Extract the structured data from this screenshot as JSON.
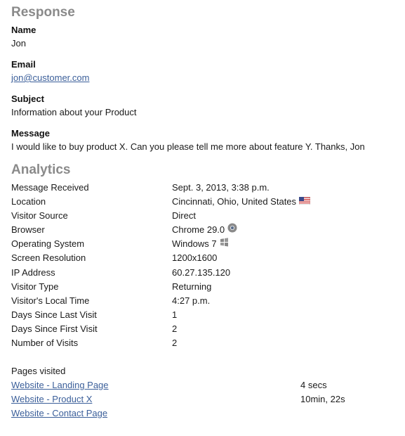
{
  "response": {
    "heading": "Response",
    "fields": [
      {
        "label": "Name",
        "value": "Jon",
        "is_link": false
      },
      {
        "label": "Email",
        "value": "jon@customer.com",
        "is_link": true
      },
      {
        "label": "Subject",
        "value": "Information about your Product",
        "is_link": false
      },
      {
        "label": "Message",
        "value": "I would like to buy product X. Can you please tell me more about feature Y. Thanks, Jon",
        "is_link": false
      }
    ]
  },
  "analytics": {
    "heading": "Analytics",
    "rows": [
      {
        "key": "Message Received",
        "value": "Sept. 3, 2013, 3:38 p.m.",
        "icon": ""
      },
      {
        "key": "Location",
        "value": "Cincinnati, Ohio, United States",
        "icon": "us-flag-icon"
      },
      {
        "key": "Visitor Source",
        "value": "Direct",
        "icon": ""
      },
      {
        "key": "Browser",
        "value": "Chrome 29.0",
        "icon": "chrome-icon"
      },
      {
        "key": "Operating System",
        "value": "Windows 7",
        "icon": "windows-icon"
      },
      {
        "key": "Screen Resolution",
        "value": "1200x1600",
        "icon": ""
      },
      {
        "key": "IP Address",
        "value": "60.27.135.120",
        "icon": ""
      },
      {
        "key": "Visitor Type",
        "value": "Returning",
        "icon": ""
      },
      {
        "key": "Visitor's Local Time",
        "value": "4:27 p.m.",
        "icon": ""
      },
      {
        "key": "Days Since Last Visit",
        "value": "1",
        "icon": ""
      },
      {
        "key": "Days Since First Visit",
        "value": "2",
        "icon": ""
      },
      {
        "key": "Number of Visits",
        "value": "2",
        "icon": ""
      }
    ]
  },
  "pages": {
    "title": "Pages visited",
    "items": [
      {
        "label": "Website - Landing Page",
        "time": "4 secs"
      },
      {
        "label": "Website - Product X",
        "time": "10min, 22s"
      },
      {
        "label": "Website - Contact Page",
        "time": ""
      }
    ]
  },
  "colors": {
    "heading": "#8a8a8a",
    "link": "#3b5f9a",
    "text": "#1a1a1a"
  }
}
